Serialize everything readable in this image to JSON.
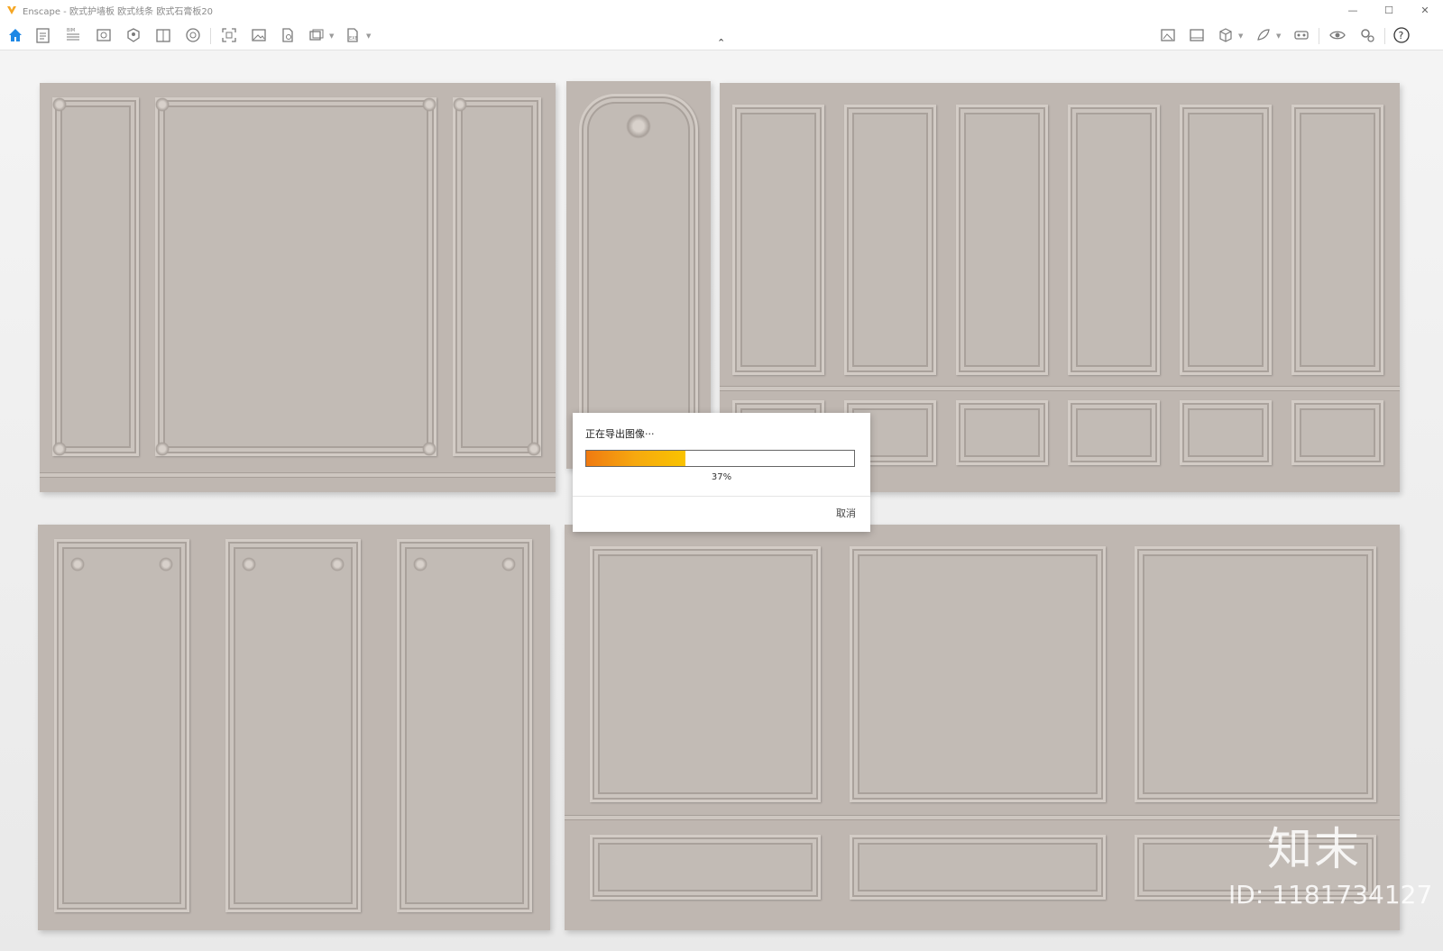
{
  "window": {
    "title": "Enscape - 欧式护墙板 欧式线条 欧式石膏板20",
    "controls": {
      "minimize": "—",
      "maximize": "☐",
      "close": "✕"
    }
  },
  "toolbar": {
    "left_icons": [
      "home-icon",
      "document-icon",
      "bim-icon",
      "view-icon",
      "map-icon",
      "book-icon",
      "settings-sphere-icon",
      "capture-icon",
      "image-icon",
      "file-icon",
      "batch-icon",
      "export-icon"
    ],
    "right_icons": [
      "image-export-icon",
      "gallery-icon",
      "cube-icon",
      "asset-icon",
      "vr-icon",
      "eye-icon",
      "gear-icon",
      "help-icon"
    ],
    "help_label": "?",
    "collapse_glyph": "⌃",
    "accent_color": "#1e88e5"
  },
  "dialog": {
    "message": "正在导出图像···",
    "progress_percent": 37,
    "progress_label": "37%",
    "cancel_label": "取消"
  },
  "watermark": {
    "stamp": "知末",
    "id_text": "ID: 1181734127"
  }
}
